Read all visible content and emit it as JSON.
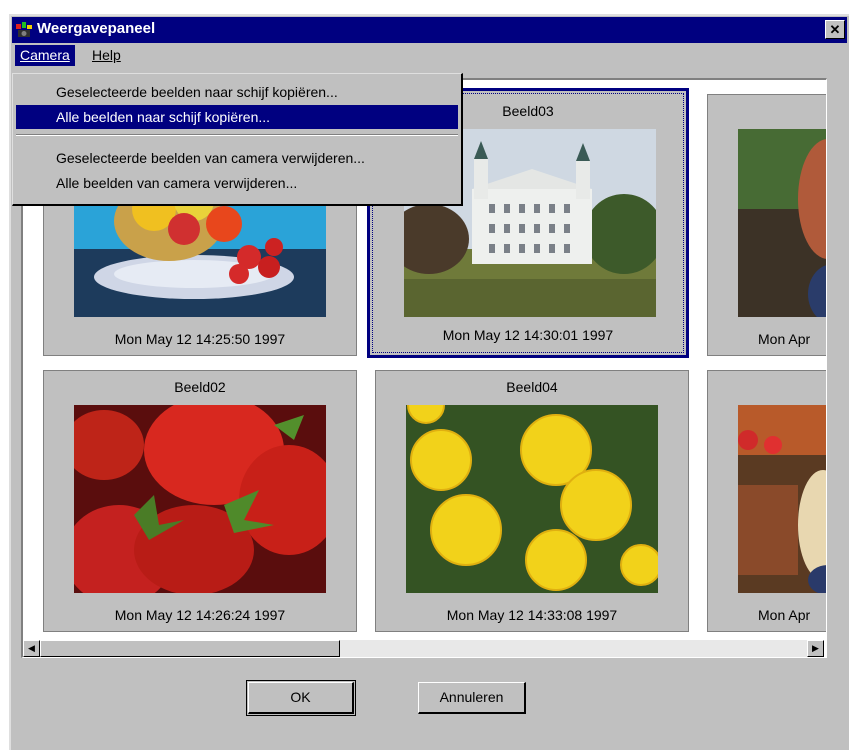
{
  "window": {
    "title": "Weergavepaneel",
    "close_glyph": "✕"
  },
  "menubar": {
    "camera": "Camera",
    "help": "Help"
  },
  "menu": {
    "items": [
      "Geselecteerde beelden naar schijf kopiëren...",
      "Alle beelden naar schijf kopiëren...",
      "Geselecteerde beelden van camera verwijderen...",
      "Alle beelden van camera verwijderen..."
    ]
  },
  "tiles": [
    {
      "name": "",
      "date": "Mon May 12 14:25:50 1997"
    },
    {
      "name": "Beeld03",
      "date": "Mon May 12 14:30:01 1997"
    },
    {
      "name": "",
      "date": "Mon Apr"
    },
    {
      "name": "Beeld02",
      "date": "Mon May 12 14:26:24 1997"
    },
    {
      "name": "Beeld04",
      "date": "Mon May 12 14:33:08 1997"
    },
    {
      "name": "",
      "date": "Mon Apr"
    }
  ],
  "buttons": {
    "ok": "OK",
    "cancel": "Annuleren"
  },
  "scroll": {
    "left": "◀",
    "right": "▶"
  },
  "colors": {
    "titlebar": "#000080",
    "face": "#c0c0c0",
    "selection": "#000080"
  }
}
